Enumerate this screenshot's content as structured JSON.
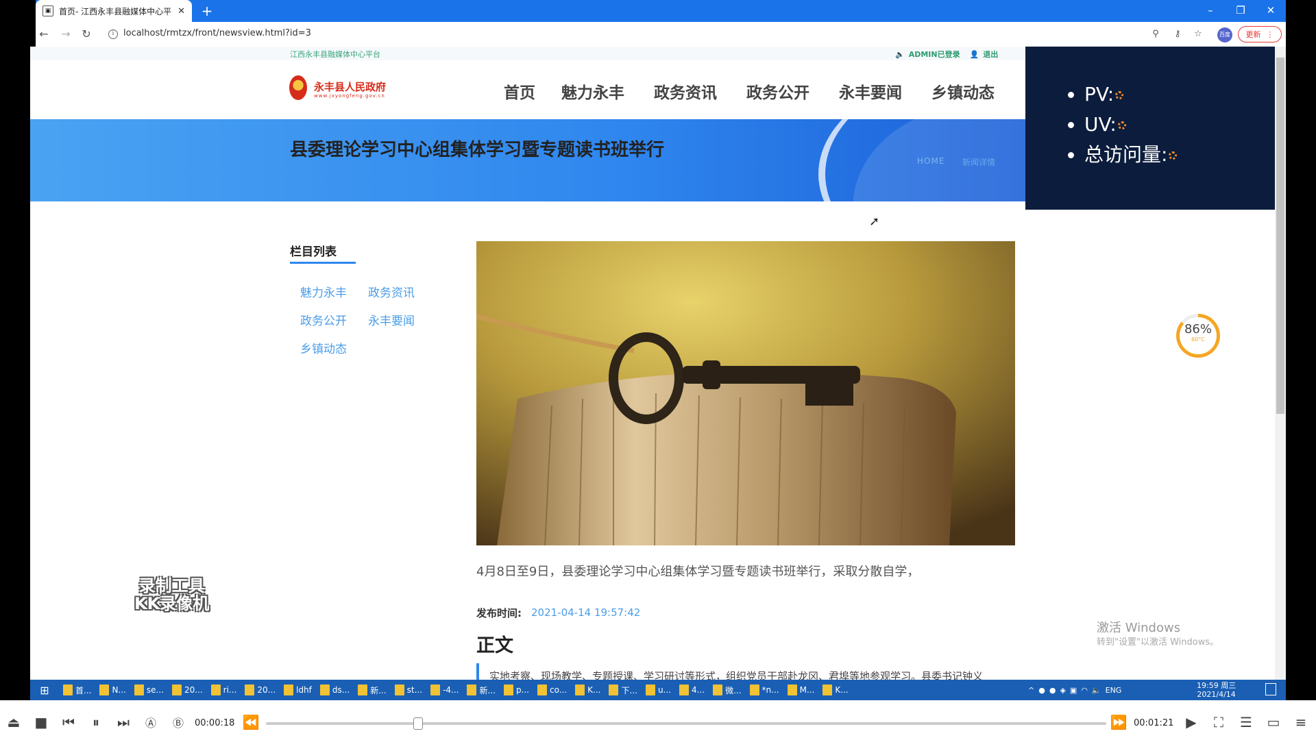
{
  "browser": {
    "tab_title": "首页- 江西永丰县融媒体中心平台",
    "url": "localhost/rmtzx/front/newsview.html?id=3",
    "update_label": "更新",
    "profile_label": "百度"
  },
  "site": {
    "platform_name": "江西永丰县融媒体中心平台",
    "user_status": "ADMIN已登录",
    "logout_label": "退出",
    "logo_title": "永丰县人民政府",
    "logo_subtitle": "www.jxyongfeng.gov.cn",
    "nav": [
      "首页",
      "魅力永丰",
      "政务资讯",
      "政务公开",
      "永丰要闻",
      "乡镇动态"
    ]
  },
  "banner": {
    "title": "县委理论学习中心组集体学习暨专题读书班举行",
    "breadcrumb_home": "HOME",
    "breadcrumb_current": "新闻详情"
  },
  "stats": {
    "pv_label": "PV:",
    "uv_label": "UV:",
    "total_label": "总访问量:"
  },
  "sidebar": {
    "title": "栏目列表",
    "links": [
      "魅力永丰",
      "政务资讯",
      "政务公开",
      "永丰要闻",
      "乡镇动态"
    ]
  },
  "article": {
    "summary": "4月8日至9日，县委理论学习中心组集体学习暨专题读书班举行，采取分散自学，",
    "publish_label": "发布时间:",
    "publish_time": "2021-04-14 19:57:42",
    "body_heading": "正文",
    "body_first_line": "实地考察、现场教学、专题授课、学习研讨等形式，组织党员干部赴龙冈、君埠等地参观学习。县委书记钟义"
  },
  "widgets": {
    "gauge_percent": 86,
    "gauge_value": "86%",
    "gauge_temp": "60°C",
    "watermark": [
      "录制工具",
      "KK录像机"
    ],
    "activate_title": "激活 Windows",
    "activate_sub": "转到\"设置\"以激活 Windows。"
  },
  "taskbar": {
    "items": [
      "首...",
      "N...",
      "se...",
      "20...",
      "ri...",
      "20...",
      "ldhf",
      "ds...",
      "新...",
      "st...",
      "-4...",
      "新...",
      "p...",
      "co...",
      "K...",
      "下...",
      "u...",
      "4...",
      "微...",
      "*n...",
      "M...",
      "K..."
    ],
    "lang": "ENG",
    "time": "19:59 周三",
    "date": "2021/4/14"
  },
  "player": {
    "elapsed": "00:00:18",
    "total": "00:01:21",
    "progress_fraction": 0.18
  },
  "colors": {
    "browser_blue": "#1a73e8",
    "banner_blue": "#2f86ee",
    "stats_bg": "#0c1c3c",
    "link_blue": "#4a9de8",
    "gauge_orange": "#f5a623"
  }
}
